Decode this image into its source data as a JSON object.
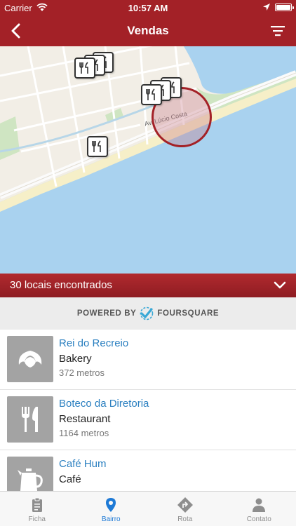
{
  "status_bar": {
    "carrier": "Carrier",
    "time": "10:57 AM"
  },
  "nav": {
    "title": "Vendas",
    "back_icon": "chevron-left-icon",
    "filter_icon": "filter-lines-icon"
  },
  "map": {
    "street_label": "Av. Lúcio Costa",
    "pin_icon": "fork-knife-icon"
  },
  "results": {
    "count_text": "30 locais encontrados",
    "toggle_icon": "chevron-down-icon"
  },
  "powered_by": {
    "prefix": "POWERED BY",
    "brand": "FOURSQUARE"
  },
  "venues": [
    {
      "name": "Rei do Recreio",
      "category": "Bakery",
      "distance": "372 metros",
      "icon": "croissant-icon"
    },
    {
      "name": "Boteco da Diretoria",
      "category": "Restaurant",
      "distance": "1164 metros",
      "icon": "fork-knife-icon"
    },
    {
      "name": "Café Hum",
      "category": "Café",
      "distance": "",
      "icon": "coffee-pot-icon"
    }
  ],
  "tabs": [
    {
      "label": "Ficha",
      "icon": "clipboard-icon",
      "active": false
    },
    {
      "label": "Bairro",
      "icon": "location-pin-icon",
      "active": true
    },
    {
      "label": "Rota",
      "icon": "route-sign-icon",
      "active": false
    },
    {
      "label": "Contato",
      "icon": "person-icon",
      "active": false
    }
  ],
  "colors": {
    "brand_red": "#a32127",
    "link_blue": "#2a7fc0",
    "tab_active": "#1e7ad6",
    "water": "#a9d2ef"
  }
}
